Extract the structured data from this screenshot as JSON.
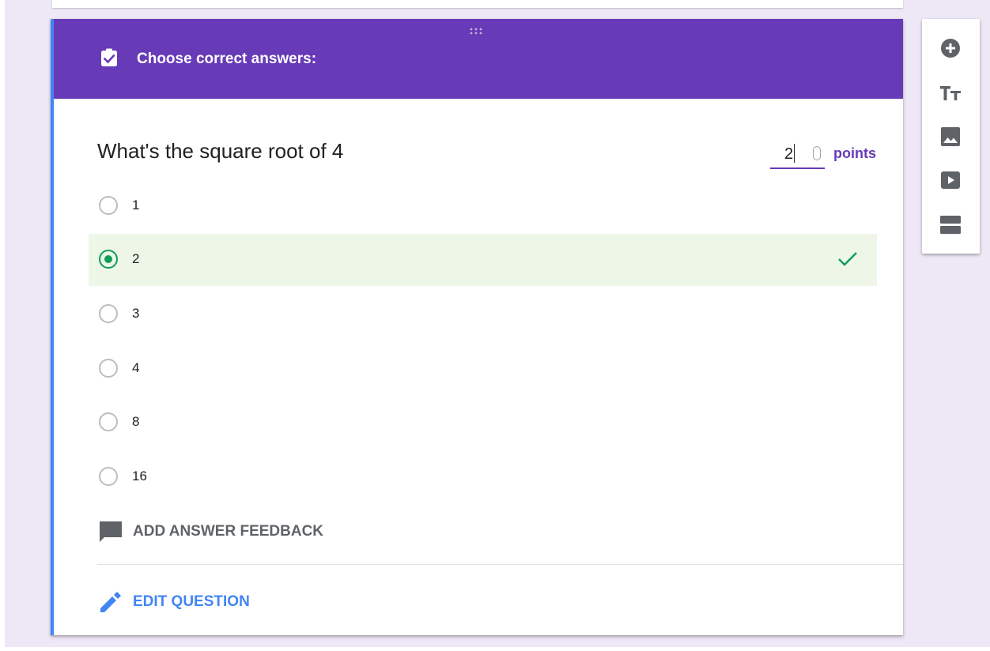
{
  "header": {
    "title": "Choose correct answers:",
    "icon": "assignment-turned-in-icon",
    "accent_color": "#673ab7"
  },
  "question": {
    "text": "What's the square root of 4",
    "points_value": "2",
    "points_label": "points"
  },
  "options": [
    {
      "label": "1",
      "selected": false,
      "correct": false
    },
    {
      "label": "2",
      "selected": true,
      "correct": true
    },
    {
      "label": "3",
      "selected": false,
      "correct": false
    },
    {
      "label": "4",
      "selected": false,
      "correct": false
    },
    {
      "label": "8",
      "selected": false,
      "correct": false
    },
    {
      "label": "16",
      "selected": false,
      "correct": false
    }
  ],
  "actions": {
    "feedback_label": "ADD ANSWER FEEDBACK",
    "feedback_icon": "comment-icon",
    "edit_label": "EDIT QUESTION",
    "edit_icon": "pencil-icon"
  },
  "colors": {
    "correct_green": "#0f9d58",
    "correct_bg": "#eef6e8",
    "link_blue": "#4285f4",
    "background": "#ede7f6"
  },
  "toolbar": {
    "items": [
      {
        "icon": "add-circle-icon",
        "name": "add-question"
      },
      {
        "icon": "title-text-icon",
        "name": "add-title"
      },
      {
        "icon": "image-icon",
        "name": "add-image"
      },
      {
        "icon": "video-icon",
        "name": "add-video"
      },
      {
        "icon": "section-icon",
        "name": "add-section"
      }
    ]
  }
}
